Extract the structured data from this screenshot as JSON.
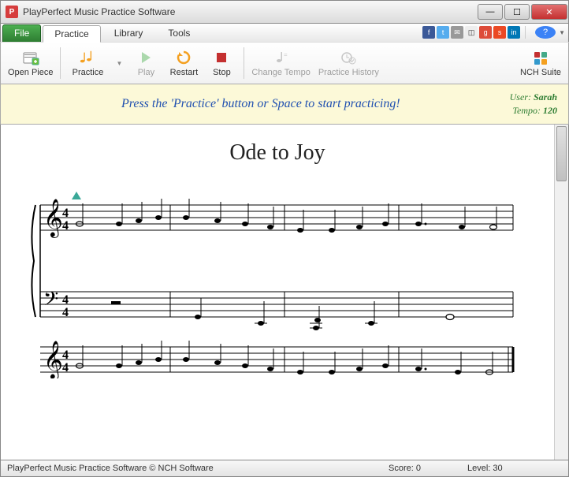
{
  "window": {
    "title": "PlayPerfect Music Practice Software",
    "icon_letter": "P"
  },
  "menu": {
    "file": "File",
    "practice": "Practice",
    "library": "Library",
    "tools": "Tools"
  },
  "toolbar": {
    "open_piece": "Open Piece",
    "practice": "Practice",
    "play": "Play",
    "restart": "Restart",
    "stop": "Stop",
    "change_tempo": "Change Tempo",
    "practice_history": "Practice History",
    "nch_suite": "NCH Suite"
  },
  "banner": {
    "message": "Press the 'Practice' button or Space to start practicing!",
    "user_label": "User:",
    "user_value": "Sarah",
    "tempo_label": "Tempo:",
    "tempo_value": "120"
  },
  "sheet": {
    "title": "Ode to Joy"
  },
  "status": {
    "product": "PlayPerfect Music Practice Software © NCH Software",
    "score_label": "Score:",
    "score_value": "0",
    "level_label": "Level:",
    "level_value": "30"
  }
}
